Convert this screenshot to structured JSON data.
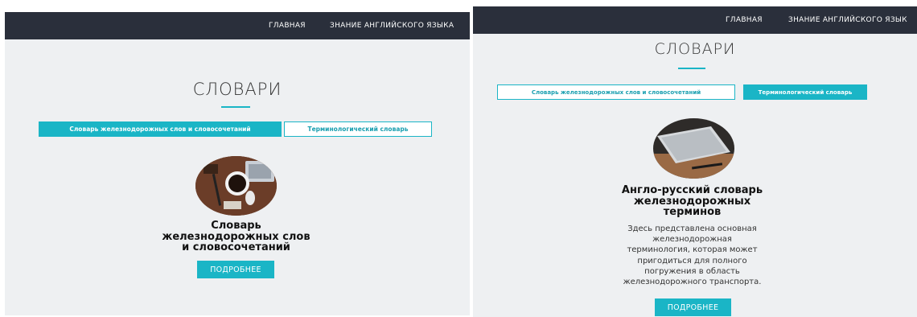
{
  "screens": [
    {
      "nav": {
        "home": "ГЛАВНАЯ",
        "english": "ЗНАНИЕ АНГЛИЙСКОГО ЯЗЫКА"
      },
      "title": "СЛОВАРИ",
      "tabs": [
        {
          "label": "Словарь железнодорожных слов и словосочетаний",
          "active": true
        },
        {
          "label": "Терминологический словарь",
          "active": false
        }
      ],
      "card": {
        "title_lines": [
          "Словарь",
          "железнодорожных слов",
          "и словосочетаний"
        ],
        "description_lines": [],
        "button": "ПОДРОБНЕЕ"
      }
    },
    {
      "nav": {
        "home": "ГЛАВНАЯ",
        "english": "ЗНАНИЕ АНГЛИЙСКОГО ЯЗЫК"
      },
      "title": "СЛОВАРИ",
      "tabs": [
        {
          "label": "Словарь железнодорожных слов и словосочетаний",
          "active": false
        },
        {
          "label": "Терминологический словарь",
          "active": true
        }
      ],
      "card": {
        "title_lines": [
          "Англо-русский словарь",
          "железнодорожных",
          "терминов"
        ],
        "description_lines": [
          "Здесь представлена основная",
          "железнодорожная",
          "терминология, которая может",
          "пригодиться для полного",
          "погружения в область",
          "железнодорожного транспорта."
        ],
        "button": "ПОДРОБНЕЕ"
      }
    }
  ],
  "colors": {
    "navbar": "#2a2f3b",
    "accent": "#1ab5c6",
    "background": "#eef0f2"
  },
  "icons": {
    "left_image": "desk-with-coffee-photo",
    "right_image": "laptop-on-desk-photo"
  }
}
